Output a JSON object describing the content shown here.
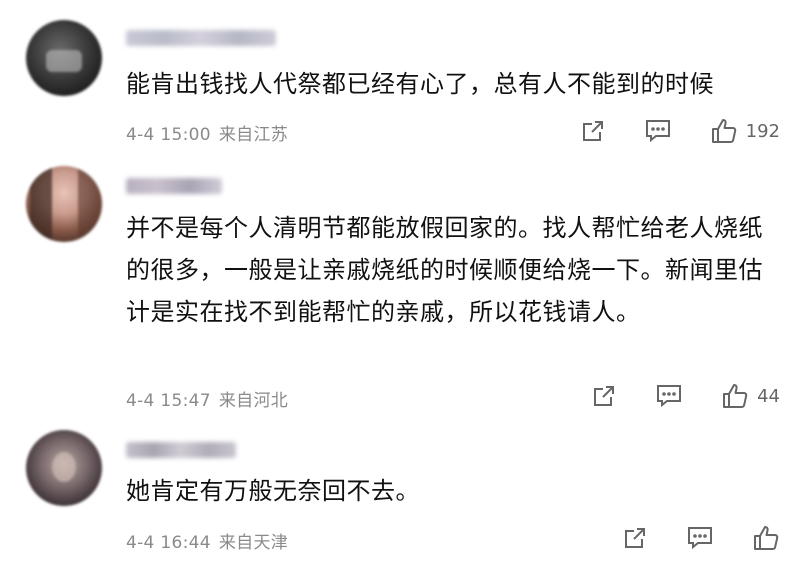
{
  "comments": [
    {
      "text": "能肯出钱找人代祭都已经有心了，总有人不能到的时候",
      "time": "4-4 15:00",
      "location": "来自江苏",
      "likes": "192"
    },
    {
      "text": "并不是每个人清明节都能放假回家的。找人帮忙给老人烧纸的很多，一般是让亲戚烧纸的时候顺便给烧一下。新闻里估计是实在找不到能帮忙的亲戚，所以花钱请人。",
      "time": "4-4 15:47",
      "location": "来自河北",
      "likes": "44"
    },
    {
      "text": "她肯定有万般无奈回不去。",
      "time": "4-4 16:44",
      "location": "来自天津",
      "likes": ""
    }
  ],
  "icons": {
    "share": "share-icon",
    "reply": "comment-icon",
    "like": "thumbs-up-icon"
  },
  "colors": {
    "text": "#111111",
    "meta": "#8a8a8a",
    "icon": "#666666"
  }
}
